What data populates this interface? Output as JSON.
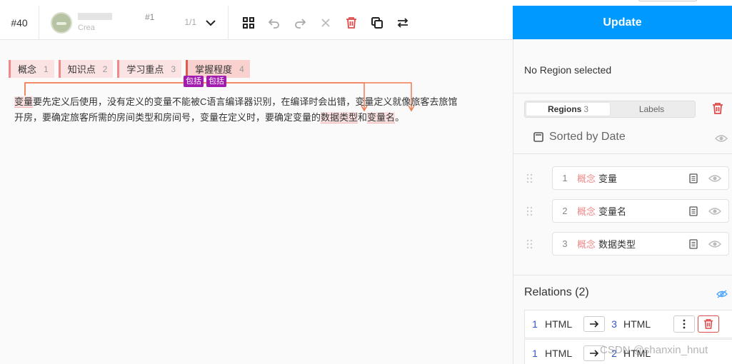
{
  "topbar": {
    "task_id": "#40",
    "annotation_number": "#1",
    "annotation_created": "Crea",
    "page": "1/1"
  },
  "sidebar": {
    "update_label": "Update",
    "no_region": "No Region selected",
    "tabs": [
      {
        "label": "Regions",
        "count": "3"
      },
      {
        "label": "Labels",
        "count": ""
      }
    ],
    "sort_label": "Sorted by Date",
    "regions": [
      {
        "index": "1",
        "label": "概念",
        "text": "变量"
      },
      {
        "index": "2",
        "label": "概念",
        "text": "变量名"
      },
      {
        "index": "3",
        "label": "概念",
        "text": "数据类型"
      }
    ],
    "relations_title": "Relations (2)",
    "relations": [
      {
        "from_id": "1",
        "from_type": "HTML",
        "to_id": "3",
        "to_type": "HTML"
      },
      {
        "from_id": "1",
        "from_type": "HTML",
        "to_id": "2",
        "to_type": "HTML"
      }
    ]
  },
  "labels": [
    {
      "name": "概念",
      "hotkey": "1"
    },
    {
      "name": "知识点",
      "hotkey": "2"
    },
    {
      "name": "学习重点",
      "hotkey": "3"
    },
    {
      "name": "掌握程度",
      "hotkey": "4"
    }
  ],
  "relation_badges": [
    "包括",
    "包括"
  ],
  "text": {
    "line1": [
      {
        "t": "变量",
        "hl": true
      },
      {
        "t": "要先定义后使用，没有定义的变量不能被C语言编译器识别，在编译时会出错，变量定义就像旅客去旅馆",
        "hl": false
      }
    ],
    "line2": [
      {
        "t": "开房，要确定旅客所需的房间类型和房间号，变量在定义时，要确定变量的",
        "hl": false
      },
      {
        "t": "数据类型",
        "hl": true
      },
      {
        "t": "和",
        "hl": false
      },
      {
        "t": "变量名",
        "hl": true
      },
      {
        "t": "。",
        "hl": false
      }
    ]
  },
  "watermark": "CSDN @shanxin_hnut",
  "colors": {
    "accent": "#0099ff",
    "label": "#f08a8a",
    "relation": "#a21caf",
    "arc": "#f07b4f",
    "danger": "#e04b4b"
  },
  "icons": [
    "avatar",
    "chevron-down-icon",
    "grid-icon",
    "undo-icon",
    "redo-icon",
    "close-icon",
    "trash-icon",
    "copy-icon",
    "swap-icon",
    "sort-date-icon",
    "eye-icon",
    "grip-icon",
    "note-icon",
    "eye-off-icon",
    "arrow-right-icon",
    "more-vertical-icon"
  ]
}
